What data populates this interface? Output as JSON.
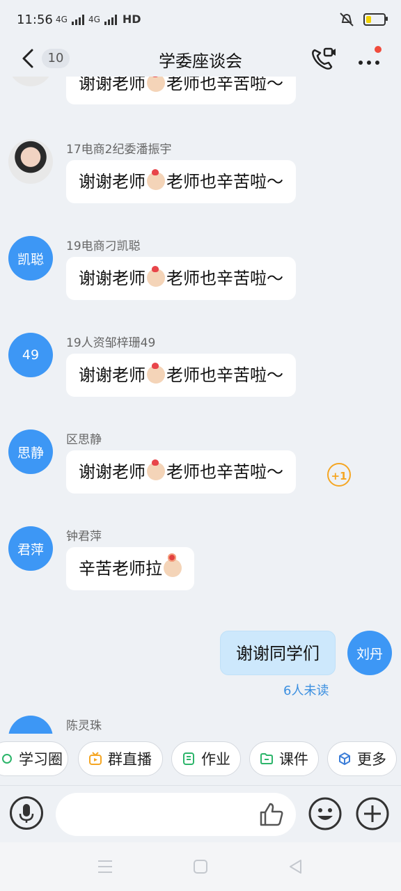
{
  "status": {
    "time": "11:56",
    "net1": "4G",
    "net2": "4G",
    "hd": "HD"
  },
  "header": {
    "back_badge": "10",
    "title": "学委座谈会"
  },
  "messages": [
    {
      "sender": "17电商2纪委潘振宇",
      "text_a": "谢谢老师",
      "text_b": "老师也辛苦啦～"
    },
    {
      "sender": "19电商刁凯聪",
      "avatar": "凯聪",
      "text_a": "谢谢老师",
      "text_b": "老师也辛苦啦～"
    },
    {
      "sender": "19人资邹梓珊49",
      "avatar": "49",
      "text_a": "谢谢老师",
      "text_b": "老师也辛苦啦～"
    },
    {
      "sender": "区思静",
      "avatar": "思静",
      "text_a": "谢谢老师",
      "text_b": "老师也辛苦啦～",
      "reaction": "+1"
    },
    {
      "sender": "钟君萍",
      "avatar": "君萍",
      "text_a": "辛苦老师拉"
    },
    {
      "sender": "陈灵珠"
    }
  ],
  "top_partial": {
    "text_a": "谢谢老师",
    "text_b": "老师也辛苦啦～"
  },
  "mine": {
    "text": "谢谢同学们",
    "avatar": "刘丹",
    "unread": "6人未读"
  },
  "shortcuts": [
    "学习圈",
    "群直播",
    "作业",
    "课件",
    "更多"
  ]
}
